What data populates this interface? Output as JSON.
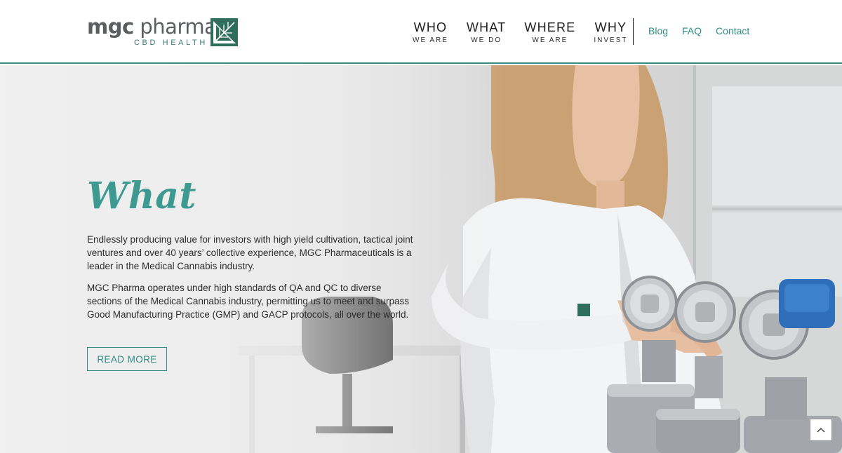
{
  "logo": {
    "name_part1": "mgc",
    "name_part2": "pharma",
    "sub": "CBD HEALTH",
    "mark_icon": "leaf-square-icon",
    "brand_color": "#2f6e5a"
  },
  "nav": {
    "items": [
      {
        "top": "WHO",
        "bottom": "WE ARE"
      },
      {
        "top": "WHAT",
        "bottom": "WE DO"
      },
      {
        "top": "WHERE",
        "bottom": "WE ARE"
      },
      {
        "top": "WHY",
        "bottom": "INVEST"
      }
    ],
    "links": [
      "Blog",
      "FAQ",
      "Contact"
    ]
  },
  "hero": {
    "title": "What",
    "paragraph1": "Endlessly producing value for investors with high yield cultivation, tactical joint ventures and over 40 years’ collective experience, MGC Pharmaceuticals is a leader in the Medical Cannabis industry.",
    "paragraph2": "MGC Pharma operates under high standards of QA and QC to diverse sections of the Medical Cannabis industry, permitting us to meet and surpass Good Manufacturing Practice (GMP) and GACP protocols, all over the world.",
    "button": "READ MORE",
    "accent_color": "#3e9a91"
  },
  "scroll_top_icon": "chevron-up-icon"
}
